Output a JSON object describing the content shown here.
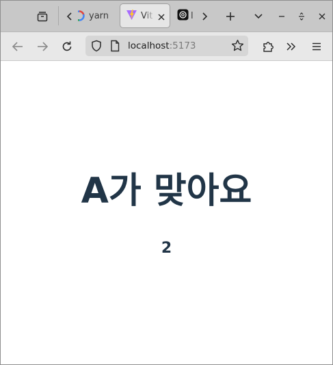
{
  "tabs": [
    {
      "title": "yarn",
      "favicon": "google-icon",
      "active": false
    },
    {
      "title": "Vit",
      "favicon": "vite-icon",
      "active": true
    },
    {
      "title": "l",
      "favicon": "chatgpt-icon",
      "active": false
    }
  ],
  "toolbar": {
    "tab_list_icon": "tab-overview-icon",
    "scroll_left_icon": "chevron-left-icon",
    "scroll_right_icon": "chevron-right-icon",
    "new_tab_icon": "plus-icon",
    "list_all_tabs_icon": "chevron-down-icon",
    "minimize_icon": "minimize-icon",
    "restore_icon": "restore-icon",
    "close_icon": "close-icon"
  },
  "navbar": {
    "url_host": "localhost",
    "url_port": ":5173",
    "back_icon": "arrow-left-icon",
    "forward_icon": "arrow-right-icon",
    "reload_icon": "reload-icon",
    "shield_icon": "shield-icon",
    "page_icon": "page-icon",
    "bookmark_icon": "star-icon",
    "extensions_icon": "puzzle-icon",
    "overflow_icon": "double-chevron-icon",
    "menu_icon": "hamburger-icon"
  },
  "page": {
    "heading": "A가 맞아요",
    "count": "2"
  },
  "colors": {
    "text": "#213547",
    "tabstrip": "#c8c8c8",
    "navbar": "#e8e8e8"
  }
}
